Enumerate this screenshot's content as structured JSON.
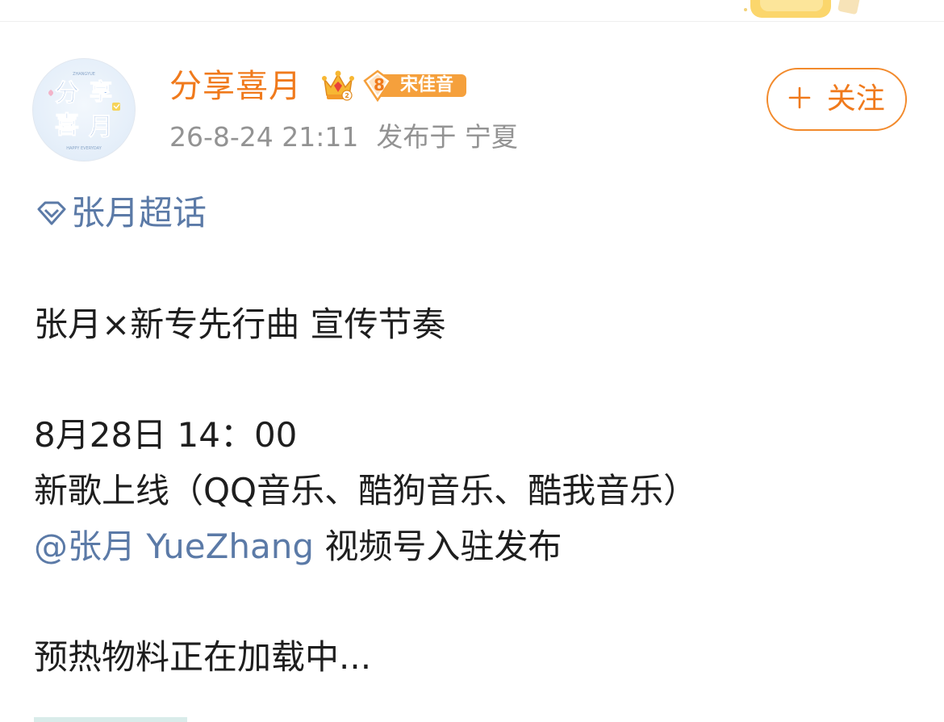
{
  "post": {
    "author": {
      "name": "分享喜月",
      "avatar_text": "分享喜月",
      "crown_icon": "crown-icon",
      "fan_badge": {
        "level": "8",
        "label": "宋佳音",
        "color": "#f5a03c"
      }
    },
    "timestamp": "26-8-24 21:11",
    "location": "发布于 宁夏",
    "follow_button": {
      "icon": "plus-icon",
      "label": "关注"
    },
    "topic": {
      "icon": "diamond-icon",
      "label": "张月超话"
    },
    "lines": {
      "line1": "张月×新专先行曲 宣传节奏",
      "line2": "8月28日 14：00",
      "line3": "新歌上线（QQ音乐、酷狗音乐、酷我音乐）",
      "line4_mention": "@张月 YueZhang",
      "line4_text": " 视频号入驻发布",
      "line5": "预热物料正在加载中..."
    }
  },
  "colors": {
    "accent_orange": "#f07a1c",
    "link_blue": "#5b7aa7",
    "meta_gray": "#939393",
    "body_text": "#1e1e1e"
  }
}
